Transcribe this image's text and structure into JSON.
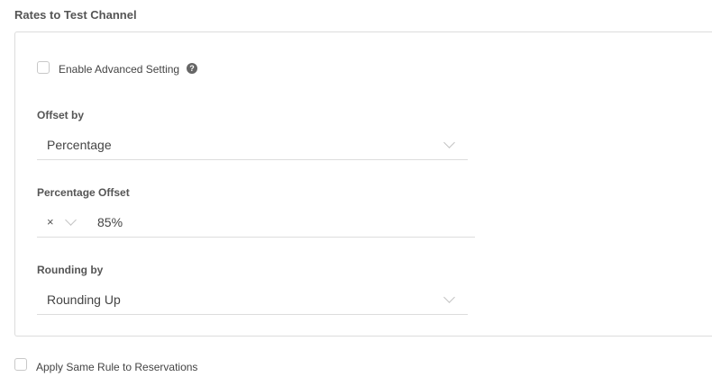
{
  "section": {
    "title": "Rates to Test Channel"
  },
  "advanced": {
    "label": "Enable Advanced Setting",
    "checked": false,
    "help_icon": "question-circle-icon",
    "help_glyph": "?"
  },
  "offset_by": {
    "label": "Offset by",
    "value": "Percentage"
  },
  "percentage_offset": {
    "label": "Percentage Offset",
    "operator": "×",
    "value": "85%"
  },
  "rounding_by": {
    "label": "Rounding by",
    "value": "Rounding Up"
  },
  "apply_reservations": {
    "label": "Apply Same Rule to Reservations",
    "checked": false
  }
}
